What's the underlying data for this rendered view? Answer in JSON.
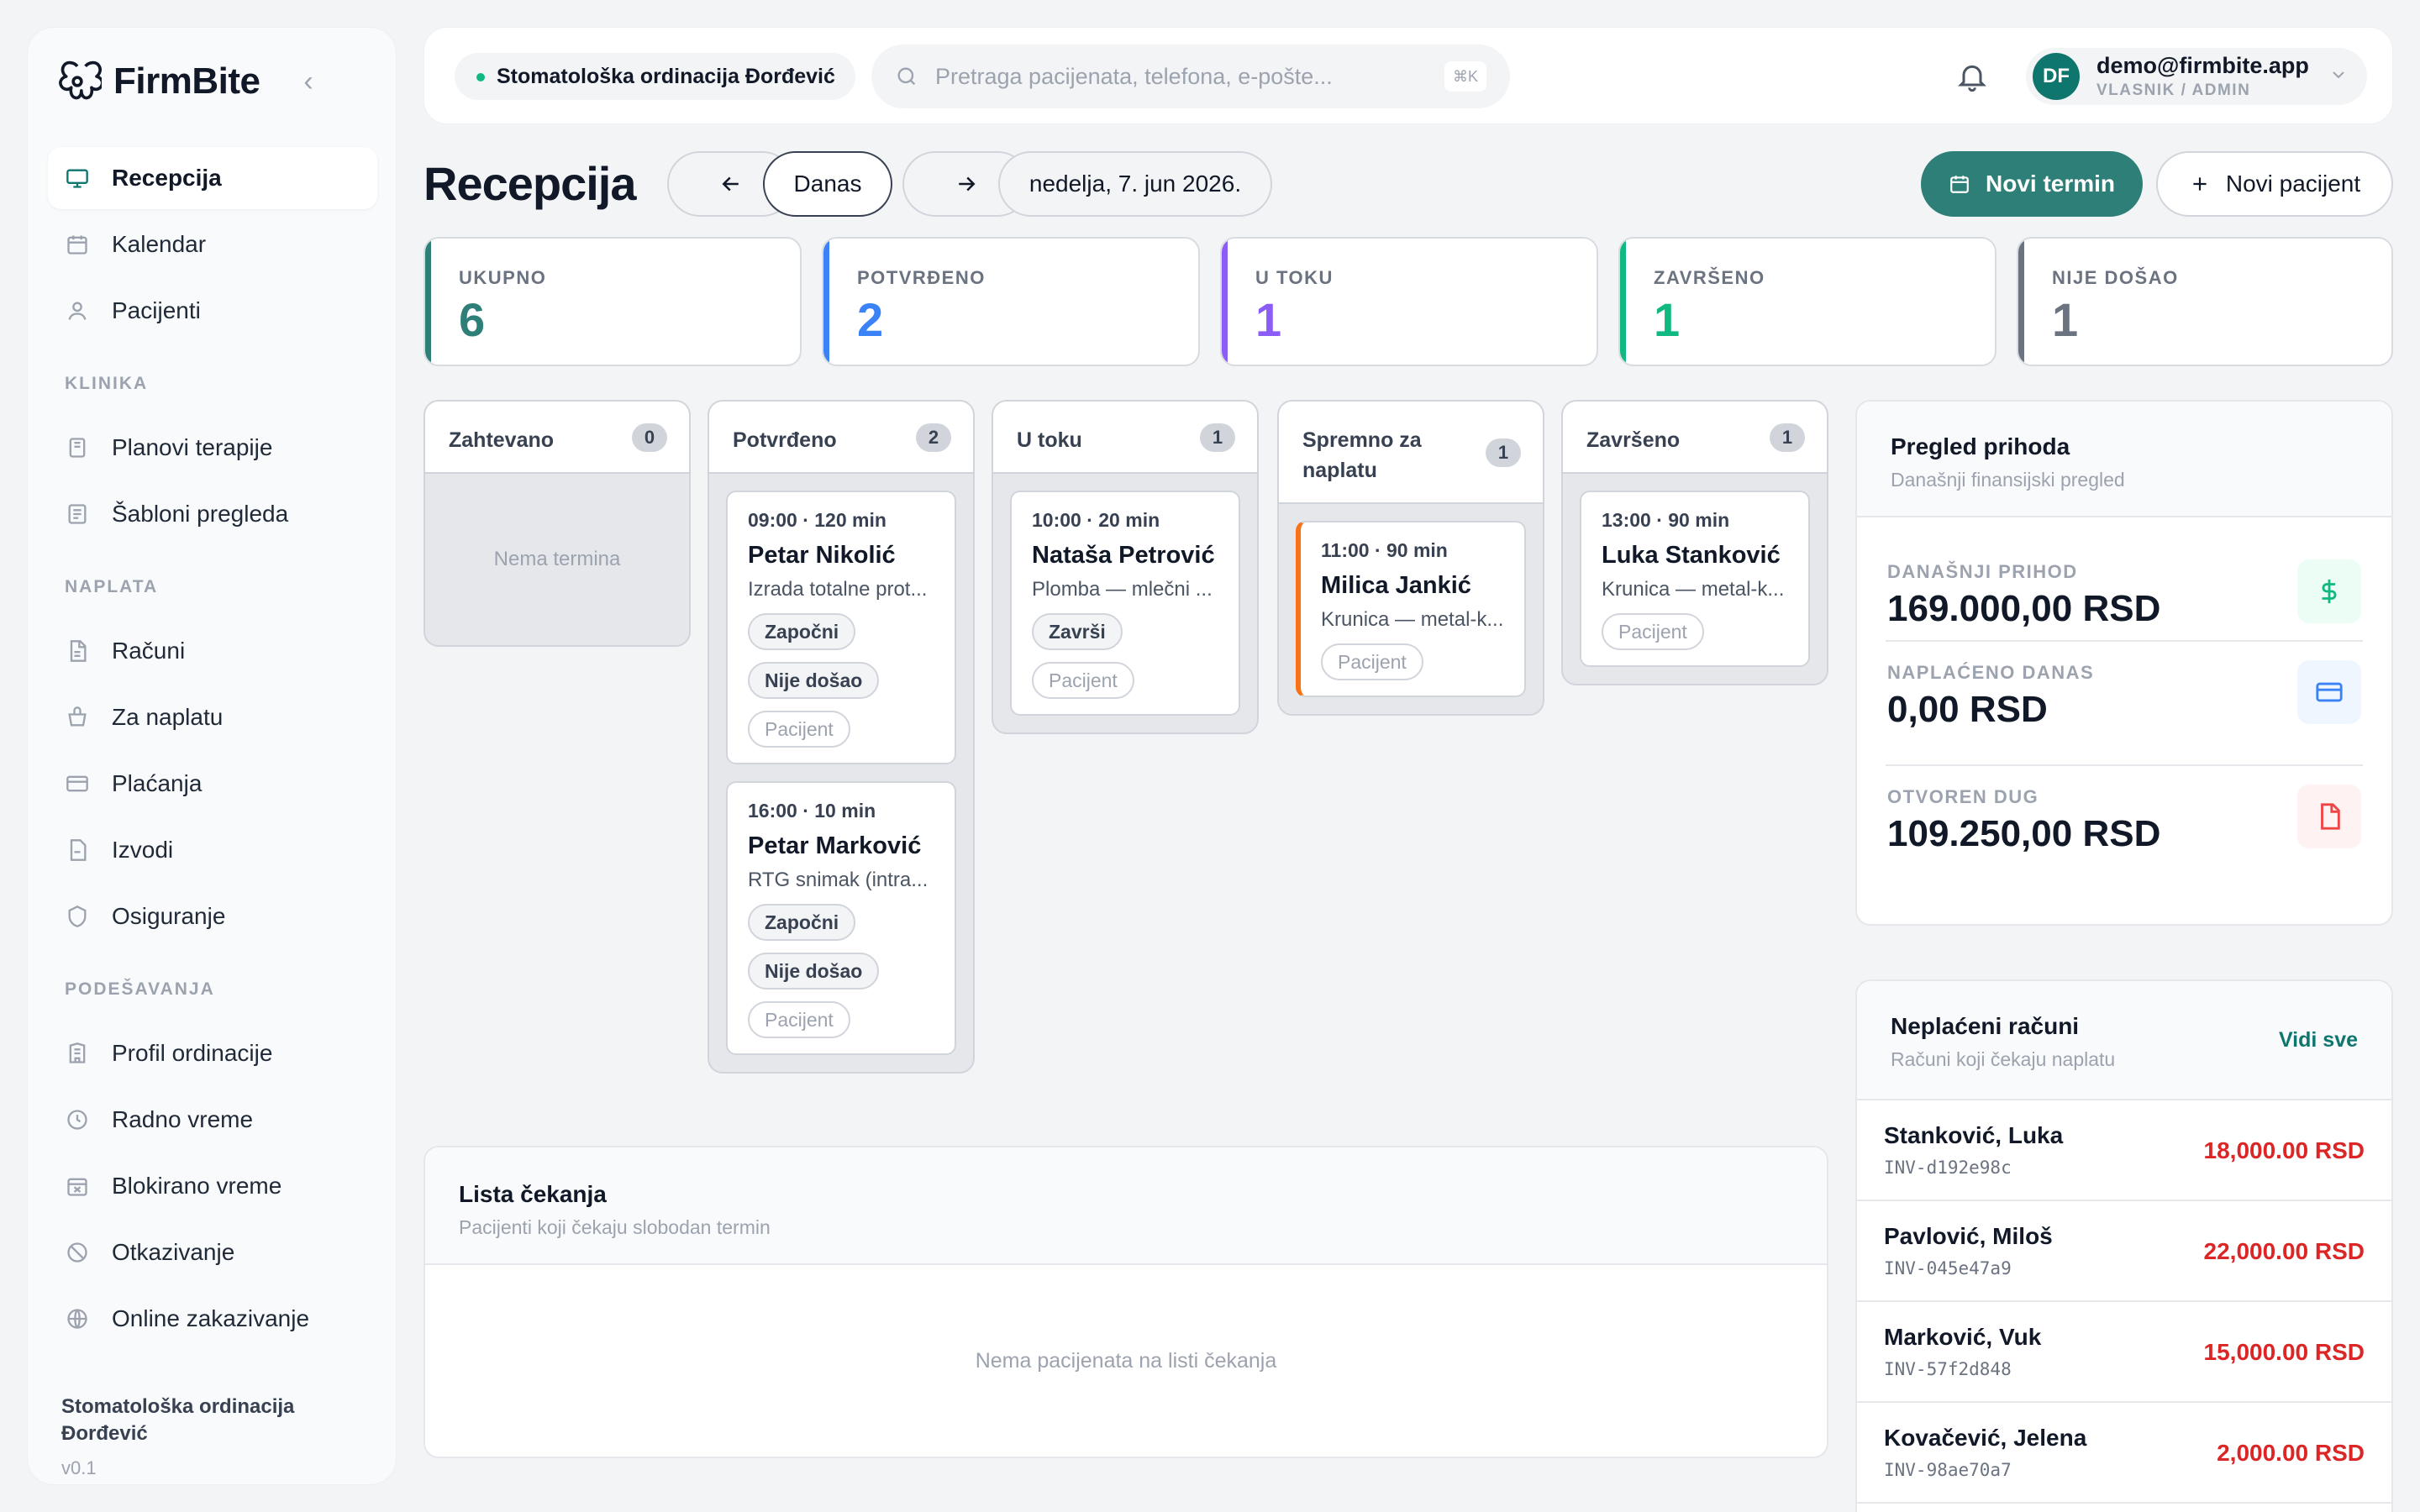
{
  "brand": {
    "name": "FirmBite"
  },
  "sidebar": {
    "main": [
      {
        "label": "Recepcija",
        "icon": "monitor-icon",
        "active": true
      },
      {
        "label": "Kalendar",
        "icon": "calendar-icon"
      },
      {
        "label": "Pacijenti",
        "icon": "user-icon"
      }
    ],
    "sections": [
      {
        "title": "KLINIKA",
        "items": [
          {
            "label": "Planovi terapije",
            "icon": "clipboard-icon"
          },
          {
            "label": "Šabloni pregleda",
            "icon": "list-icon"
          }
        ]
      },
      {
        "title": "NAPLATA",
        "items": [
          {
            "label": "Računi",
            "icon": "document-icon"
          },
          {
            "label": "Za naplatu",
            "icon": "basket-icon"
          },
          {
            "label": "Plaćanja",
            "icon": "credit-card-icon"
          },
          {
            "label": "Izvodi",
            "icon": "statement-icon"
          },
          {
            "label": "Osiguranje",
            "icon": "shield-icon"
          }
        ]
      },
      {
        "title": "PODEŠAVANJA",
        "items": [
          {
            "label": "Profil ordinacije",
            "icon": "building-icon"
          },
          {
            "label": "Radno vreme",
            "icon": "clock-icon"
          },
          {
            "label": "Blokirano vreme",
            "icon": "calendar-x-icon"
          },
          {
            "label": "Otkazivanje",
            "icon": "ban-icon"
          },
          {
            "label": "Online zakazivanje",
            "icon": "globe-icon"
          }
        ]
      }
    ],
    "footer": {
      "clinic": "Stomatološka ordinacija Đorđević",
      "version": "v0.1"
    }
  },
  "topbar": {
    "clinic": "Stomatološka ordinacija Đorđević",
    "search_placeholder": "Pretraga pacijenata, telefona, e-pošte...",
    "search_shortcut": "⌘K",
    "user": {
      "initials": "DF",
      "email": "demo@firmbite.app",
      "role": "VLASNIK / ADMIN"
    }
  },
  "header": {
    "title": "Recepcija",
    "today": "Danas",
    "date": "nedelja, 7. jun 2026.",
    "new_appointment": "Novi termin",
    "new_patient": "Novi pacijent"
  },
  "colors": {
    "accent": "#2f7f79",
    "total": "#2f7f79",
    "confirmed": "#3b82f6",
    "in_progress": "#8b5cf6",
    "done": "#10b981",
    "no_show": "#6b7280",
    "debt": "#dc2626"
  },
  "stats": [
    {
      "label": "UKUPNO",
      "value": "6"
    },
    {
      "label": "POTVRĐENO",
      "value": "2"
    },
    {
      "label": "U TOKU",
      "value": "1"
    },
    {
      "label": "ZAVRŠENO",
      "value": "1"
    },
    {
      "label": "NIJE DOŠAO",
      "value": "1"
    }
  ],
  "board": {
    "empty": "Nema termina",
    "columns": [
      {
        "title": "Zahtevano",
        "count": "0",
        "cards": []
      },
      {
        "title": "Potvrđeno",
        "count": "2",
        "cards": [
          {
            "time": "09:00 · 120 min",
            "patient": "Petar Nikolić",
            "service": "Izrada totalne prot...",
            "actions": [
              "Započni",
              "Nije došao",
              "Pacijent"
            ]
          },
          {
            "time": "16:00 · 10 min",
            "patient": "Petar Marković",
            "service": "RTG snimak (intra...",
            "actions": [
              "Započni",
              "Nije došao",
              "Pacijent"
            ]
          }
        ]
      },
      {
        "title": "U toku",
        "count": "1",
        "cards": [
          {
            "time": "10:00 · 20 min",
            "patient": "Nataša Petrović",
            "service": "Plomba — mlečni ...",
            "actions": [
              "Završi",
              "Pacijent"
            ]
          }
        ]
      },
      {
        "title": "Spremno za naplatu",
        "count": "1",
        "cards": [
          {
            "time": "11:00 · 90 min",
            "patient": "Milica Jankić",
            "service": "Krunica — metal-k...",
            "actions": [
              "Pacijent"
            ]
          }
        ]
      },
      {
        "title": "Završeno",
        "count": "1",
        "cards": [
          {
            "time": "13:00 · 90 min",
            "patient": "Luka Stanković",
            "service": "Krunica — metal-k...",
            "actions": [
              "Pacijent"
            ]
          }
        ]
      }
    ]
  },
  "waitlist": {
    "title": "Lista čekanja",
    "subtitle": "Pacijenti koji čekaju slobodan termin",
    "empty": "Nema pacijenata na listi čekanja"
  },
  "revenue": {
    "title": "Pregled prihoda",
    "subtitle": "Današnji finansijski pregled",
    "rows": [
      {
        "label": "DANAŠNJI PRIHOD",
        "value": "169.000,00 RSD",
        "icon": "dollar-icon"
      },
      {
        "label": "NAPLAĆENO DANAS",
        "value": "0,00 RSD",
        "icon": "credit-card-icon"
      },
      {
        "label": "OTVOREN DUG",
        "value": "109.250,00 RSD",
        "icon": "file-icon"
      }
    ]
  },
  "unpaid": {
    "title": "Neplaćeni računi",
    "subtitle": "Računi koji čekaju naplatu",
    "see_all": "Vidi sve",
    "items": [
      {
        "name": "Stanković, Luka",
        "code": "INV-d192e98c",
        "amount": "18,000.00 RSD"
      },
      {
        "name": "Pavlović, Miloš",
        "code": "INV-045e47a9",
        "amount": "22,000.00 RSD"
      },
      {
        "name": "Marković, Vuk",
        "code": "INV-57f2d848",
        "amount": "15,000.00 RSD"
      },
      {
        "name": "Kovačević, Jelena",
        "code": "INV-98ae70a7",
        "amount": "2,000.00 RSD"
      }
    ]
  }
}
